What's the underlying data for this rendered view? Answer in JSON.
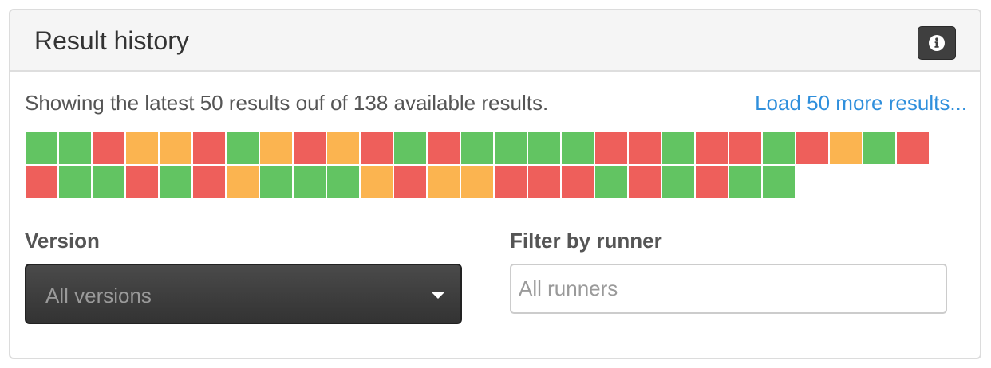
{
  "panel": {
    "title": "Result history",
    "info_icon": "info-icon"
  },
  "summary": {
    "text": "Showing the latest 50 results ouf of 138 available results.",
    "load_more": "Load 50 more results..."
  },
  "colors": {
    "pass": "#62c462",
    "fail": "#ee5f5b",
    "warn": "#fbb450"
  },
  "results": [
    "pass",
    "pass",
    "fail",
    "warn",
    "warn",
    "fail",
    "pass",
    "warn",
    "fail",
    "warn",
    "fail",
    "pass",
    "fail",
    "pass",
    "pass",
    "pass",
    "pass",
    "fail",
    "fail",
    "pass",
    "fail",
    "fail",
    "pass",
    "fail",
    "warn",
    "pass",
    "fail",
    "fail",
    "pass",
    "pass",
    "fail",
    "pass",
    "fail",
    "warn",
    "pass",
    "pass",
    "pass",
    "warn",
    "fail",
    "warn",
    "warn",
    "fail",
    "fail",
    "fail",
    "pass",
    "fail",
    "pass",
    "fail",
    "pass",
    "pass"
  ],
  "filters": {
    "version_label": "Version",
    "version_value": "All versions",
    "runner_label": "Filter by runner",
    "runner_placeholder": "All runners"
  }
}
